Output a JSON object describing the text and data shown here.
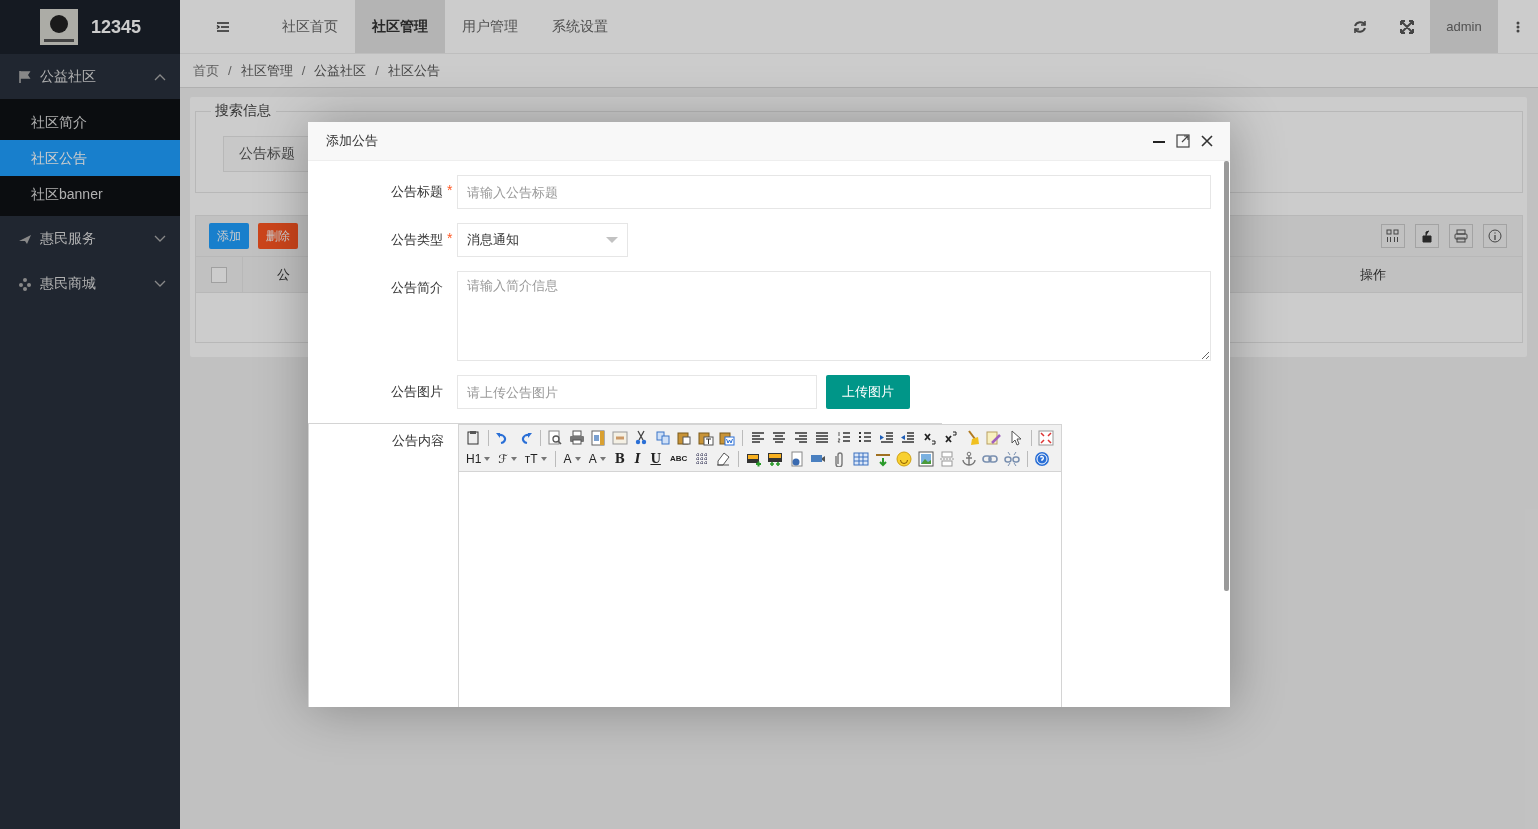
{
  "app": {
    "logo_text": "12345"
  },
  "sidebar": {
    "items": [
      {
        "label": "公益社区",
        "kind": "flag",
        "expanded": true,
        "children": [
          {
            "label": "社区简介",
            "selected": false
          },
          {
            "label": "社区公告",
            "selected": true
          },
          {
            "label": "社区banner",
            "selected": false
          }
        ]
      },
      {
        "label": "惠民服务",
        "kind": "plane",
        "expanded": false
      },
      {
        "label": "惠民商城",
        "kind": "flower",
        "expanded": false
      }
    ]
  },
  "header": {
    "tabs": [
      {
        "label": "社区首页",
        "selected": false
      },
      {
        "label": "社区管理",
        "selected": true
      },
      {
        "label": "用户管理",
        "selected": false
      },
      {
        "label": "系统设置",
        "selected": false
      }
    ],
    "user": "admin"
  },
  "breadcrumb": [
    "首页",
    "社区管理",
    "公益社区",
    "社区公告"
  ],
  "breadcrumb_separator": "/",
  "search": {
    "legend": "搜索信息",
    "fields": [
      {
        "label": "公告标题"
      }
    ]
  },
  "table": {
    "buttons": [
      {
        "label": "添加",
        "kind": "primary"
      },
      {
        "label": "删除",
        "kind": "danger"
      }
    ],
    "columns": [
      {
        "kind": "checkbox",
        "checked": false
      },
      {
        "kind": "text",
        "label": "公"
      },
      {
        "kind": "text",
        "label": "操作"
      }
    ]
  },
  "dialog": {
    "title": "添加公告",
    "required_mark": "*",
    "fields": [
      {
        "kind": "input",
        "label": "公告标题",
        "required": true,
        "placeholder": "请输入公告标题"
      },
      {
        "kind": "select",
        "label": "公告类型",
        "required": true,
        "value": "消息通知"
      },
      {
        "kind": "textarea",
        "label": "公告简介",
        "required": false,
        "placeholder": "请输入简介信息"
      },
      {
        "kind": "upload",
        "label": "公告图片",
        "required": false,
        "placeholder": "请上传公告图片",
        "button": "上传图片"
      },
      {
        "kind": "editor",
        "label": "公告内容",
        "required": false,
        "toolbar_labels": [
          "H1",
          "ℱ",
          "ᴛT",
          "A",
          "A",
          "B",
          "I",
          "U",
          "ABC"
        ]
      }
    ]
  }
}
